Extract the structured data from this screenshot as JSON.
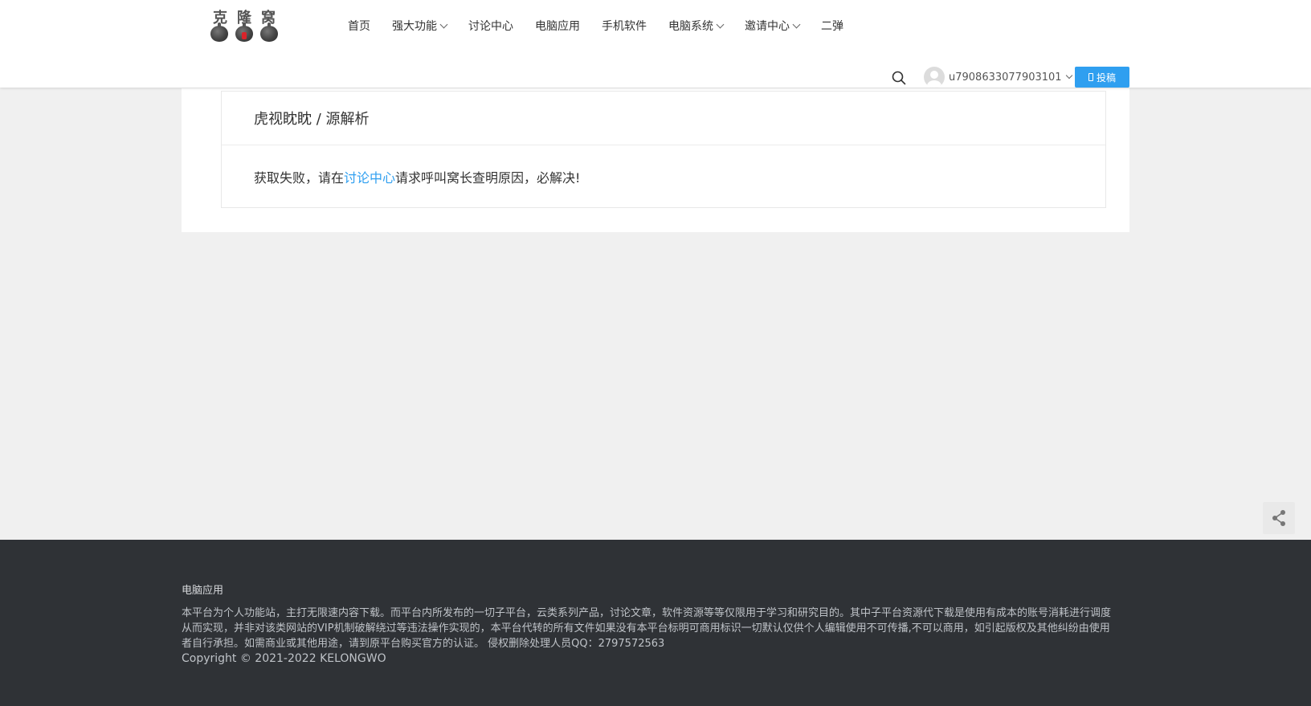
{
  "logo": {
    "chars": [
      "克",
      "隆",
      "窝"
    ]
  },
  "nav": {
    "items": [
      {
        "label": "首页",
        "has_dropdown": false
      },
      {
        "label": "强大功能",
        "has_dropdown": true
      },
      {
        "label": "讨论中心",
        "has_dropdown": false
      },
      {
        "label": "电脑应用",
        "has_dropdown": false
      },
      {
        "label": "手机软件",
        "has_dropdown": false
      },
      {
        "label": "电脑系统",
        "has_dropdown": true
      },
      {
        "label": "邀请中心",
        "has_dropdown": true
      },
      {
        "label": "二弹",
        "has_dropdown": false
      }
    ]
  },
  "header": {
    "username": "u7908633077903101",
    "post_label": "投稿",
    "icons": [
      "search-icon",
      "avatar",
      "chevron-down-icon",
      "pen-icon"
    ]
  },
  "main": {
    "breadcrumb": "虎视眈眈 / 源解析",
    "message_before": "获取失败，请在",
    "message_link": "讨论中心",
    "message_after": "请求呼叫窝长查明原因，必解决!"
  },
  "footer": {
    "title": "电脑应用",
    "description": "本平台为个人功能站，主打无限速内容下载。而平台内所发布的一切子平台，云类系列产品，讨论文章，软件资源等等仅限用于学习和研究目的。其中子平台资源代下载是使用有成本的账号消耗进行调度从而实现，并非对该类网站的VIP机制破解绕过等违法操作实现的，本平台代转的所有文件如果没有本平台标明可商用标识一切默认仅供个人编辑使用不可传播,不可以商用，如引起版权及其他纠纷由使用者自行承担。如需商业或其他用途，请到原平台购买官方的认证。 侵权删除处理人员QQ：2797572563",
    "copyright": "Copyright © 2021-2022 KELONGWO"
  },
  "colors": {
    "accent": "#2f9ff0",
    "footer_bg": "#2f3236",
    "page_bg": "#f0f0f0"
  }
}
